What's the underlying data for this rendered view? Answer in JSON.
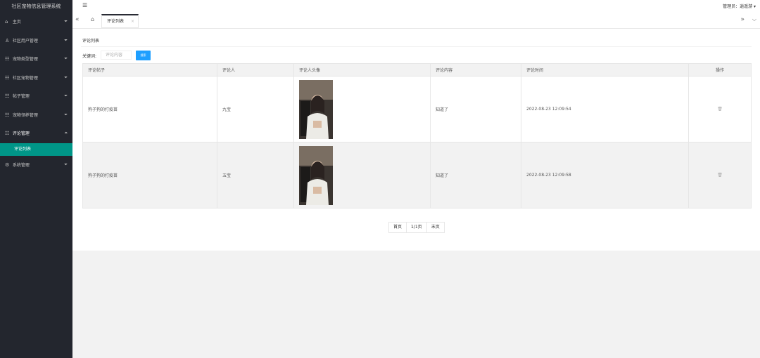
{
  "app": {
    "title": "社区宠物信息管理系统"
  },
  "sidebar": {
    "items": [
      {
        "icon": "⌂",
        "label": "主页",
        "arrow": "⏷"
      },
      {
        "icon": "♙",
        "label": "社区用户管理",
        "arrow": "⏷"
      },
      {
        "icon": "☷",
        "label": "宠物类型管理",
        "arrow": "⏷"
      },
      {
        "icon": "☷",
        "label": "社区宠物管理",
        "arrow": "⏷"
      },
      {
        "icon": "☷",
        "label": "帖子管理",
        "arrow": "⏷"
      },
      {
        "icon": "☷",
        "label": "宠物领养管理",
        "arrow": "⏷"
      },
      {
        "icon": "☷",
        "label": "评论管理",
        "arrow": "⏶"
      },
      {
        "icon": "⚙",
        "label": "系统管理",
        "arrow": "⏷"
      }
    ],
    "sub_active": "评论列表"
  },
  "topbar": {
    "menu_icon": "☰",
    "admin": "管理员：逍遥游 ▾"
  },
  "tabs": {
    "prev": "«",
    "home": "⌂",
    "active_label": "评论列表",
    "close": "×",
    "next": "»",
    "more": "⌵"
  },
  "card": {
    "title": "评论列表",
    "search_label": "关键词:",
    "search_placeholder": "评论内容",
    "search_button": "搜索"
  },
  "table": {
    "headers": [
      "评论帖子",
      "评论人",
      "评论人头像",
      "评论内容",
      "评论时间",
      "操作"
    ],
    "rows": [
      {
        "post": "狗子狗的打疫苗",
        "user": "九宝",
        "content": "知道了",
        "time": "2022-08-23 12:09:54",
        "action_icon": "🗑"
      },
      {
        "post": "狗子狗的打疫苗",
        "user": "五宝",
        "content": "知道了",
        "time": "2022-08-23 12:09:58",
        "action_icon": "🗑"
      }
    ]
  },
  "pager": {
    "first": "首页",
    "page": "1/1页",
    "last": "末页"
  }
}
